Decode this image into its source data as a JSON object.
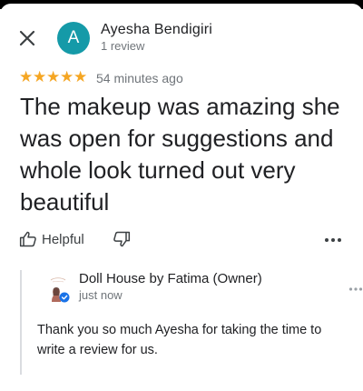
{
  "review": {
    "reviewer_name": "Ayesha Bendigiri",
    "reviewer_initial": "A",
    "review_count": "1 review",
    "rating": 5,
    "stars": [
      "★",
      "★",
      "★",
      "★",
      "★"
    ],
    "time_ago": "54 minutes ago",
    "text": "The makeup was amazing she\nwas open for  suggestions and\nwhole look turned out very\nbeautiful",
    "helpful_label": "Helpful"
  },
  "owner_reply": {
    "name": "Doll House by Fatima (Owner)",
    "time_ago": "just now",
    "text": "Thank you so much Ayesha for taking the time to write a review for us."
  },
  "icons": {
    "close": "close-icon",
    "thumbs_up": "thumbs-up-icon",
    "thumbs_down": "thumbs-down-icon",
    "more": "more-horizontal-icon",
    "verified": "verified-badge-icon"
  },
  "colors": {
    "avatar_bg": "#159aa8",
    "star": "#f5a623",
    "secondary_text": "#70757a",
    "verified": "#1a73e8",
    "divider": "#dadce0"
  }
}
